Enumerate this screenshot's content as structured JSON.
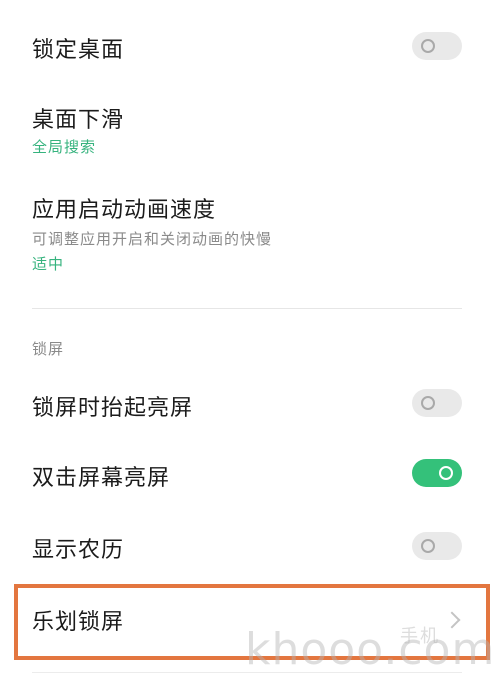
{
  "settings": {
    "lock_desktop": {
      "title": "锁定桌面",
      "enabled": false
    },
    "desktop_slide": {
      "title": "桌面下滑",
      "value": "全局搜索"
    },
    "app_animation_speed": {
      "title": "应用启动动画速度",
      "description": "可调整应用开启和关闭动画的快慢",
      "value": "适中"
    },
    "lock_section": {
      "label": "锁屏"
    },
    "raise_to_wake": {
      "title": "锁屏时抬起亮屏",
      "enabled": false
    },
    "double_tap_wake": {
      "title": "双击屏幕亮屏",
      "enabled": true
    },
    "lunar_calendar": {
      "title": "显示农历",
      "enabled": false
    },
    "lehua_lockscreen": {
      "title": "乐划锁屏"
    }
  },
  "watermark": {
    "text": "khooo.com",
    "text_cn": "手机"
  },
  "colors": {
    "accent_green": "#36b37e",
    "toggle_on": "#34c17a",
    "highlight_border": "#e3763f"
  }
}
